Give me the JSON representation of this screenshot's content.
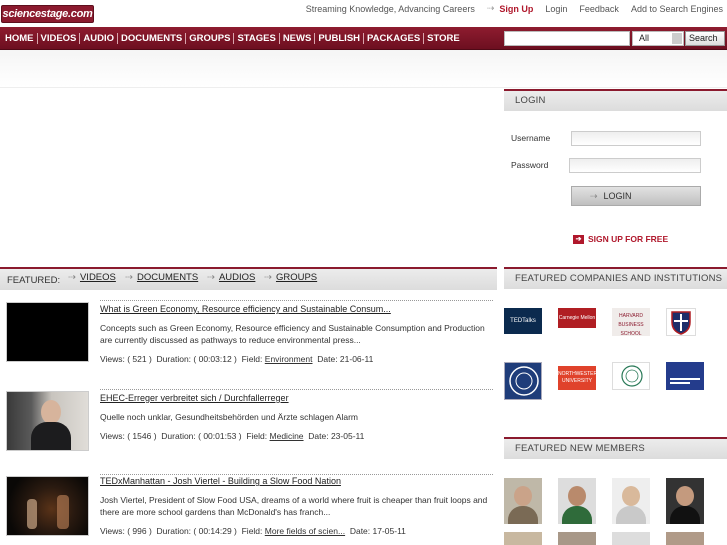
{
  "header": {
    "logo_text": "sciencestage.com",
    "tagline": "Streaming Knowledge, Advancing Careers",
    "links": [
      "Sign Up",
      "Login",
      "Feedback",
      "Add to Search Engines"
    ]
  },
  "nav": {
    "items": [
      "HOME",
      "VIDEOS",
      "AUDIO",
      "DOCUMENTS",
      "GROUPS",
      "STAGES",
      "NEWS",
      "PUBLISH",
      "PACKAGES",
      "STORE"
    ],
    "search_placeholder": "",
    "search_select": "All",
    "search_button": "Search"
  },
  "login": {
    "heading": "LOGIN",
    "username_label": "Username",
    "password_label": "Password",
    "button": "LOGIN",
    "signup": "SIGN UP FOR FREE"
  },
  "featured": {
    "label": "FEATURED:",
    "tabs": [
      "VIDEOS",
      "DOCUMENTS",
      "AUDIOS",
      "GROUPS"
    ],
    "items": [
      {
        "title": "What is Green Economy, Resource efficiency and Sustainable Consum...",
        "desc": "Concepts such as Green Economy, Resource efficiency and Sustainable Consumption and Production are currently discussed as pathways to reduce environmental press...",
        "views": "Views: ( 521 )",
        "duration": "Duration: ( 00:03:12 )",
        "field_label": "Field:",
        "field": "Environment",
        "date": "Date: 21-06-11"
      },
      {
        "title": "EHEC-Erreger verbreitet sich / Durchfallerreger",
        "desc": "Quelle noch unklar, Gesundheitsbehörden und Ärzte schlagen Alarm",
        "views": "Views: ( 1546 )",
        "duration": "Duration: ( 00:01:53 )",
        "field_label": "Field:",
        "field": "Medicine",
        "date": "Date: 23-05-11"
      },
      {
        "title": "TEDxManhattan - Josh Viertel - Building a Slow Food Nation",
        "desc": "Josh Viertel, President of Slow Food USA, dreams of a world where fruit is cheaper than fruit loops and there are more school gardens than McDonald's has franch...",
        "views": "Views: ( 996 )",
        "duration": "Duration: ( 00:14:29 )",
        "field_label": "Field:",
        "field": "More fields of scien...",
        "date": "Date: 17-05-11"
      }
    ]
  },
  "companies": {
    "heading": "FEATURED COMPANIES AND INSTITUTIONS",
    "logos": [
      "TEDTalks",
      "Carnegie Mellon",
      "HARVARD BUSINESS SCHOOL",
      "University of Edinburgh",
      "CERN",
      "NORTHWESTERN UNIVERSITY",
      "Institution seal",
      "Institution logo"
    ]
  },
  "members": {
    "heading": "FEATURED NEW MEMBERS"
  },
  "colors": {
    "brand": "#8b1a2e",
    "accent_red": "#b0182c"
  }
}
